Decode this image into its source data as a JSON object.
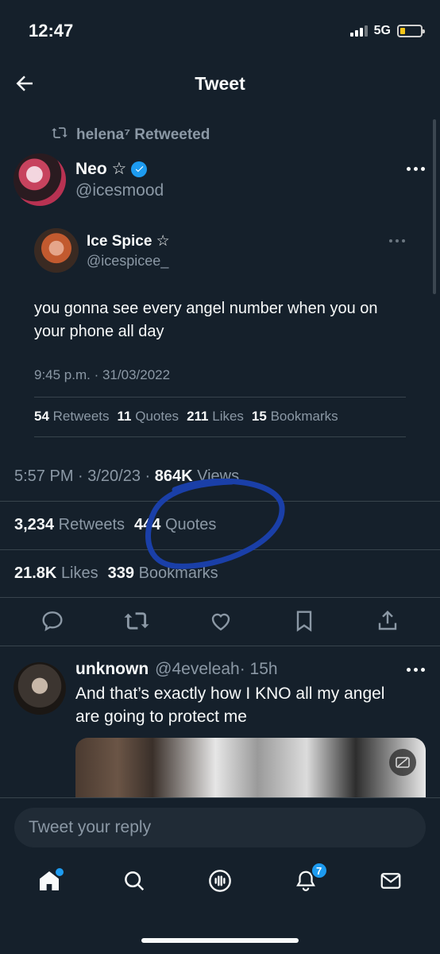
{
  "status_bar": {
    "time": "12:47",
    "network": "5G"
  },
  "header": {
    "title": "Tweet"
  },
  "retweet": {
    "label": "helena⁷ Retweeted"
  },
  "tweet": {
    "author_name": "Neo ☆",
    "author_handle": "@icesmood",
    "timestamp": "5:57 PM · 3/20/23 · ",
    "views_count": "864K",
    "views_label": " Views",
    "retweets_count": "3,234",
    "retweets_label": "Retweets",
    "quotes_count": "444",
    "quotes_label": "Quotes",
    "likes_count": "21.8K",
    "likes_label": "Likes",
    "bookmarks_count": "339",
    "bookmarks_label": "Bookmarks"
  },
  "quoted": {
    "author_name": "Ice Spice ☆",
    "author_handle": "@icespicee_",
    "text": "you gonna see every angel number when you on your phone all day",
    "timestamp": "9:45 p.m. · 31/03/2022",
    "stats": [
      {
        "count": "54",
        "label": "Retweets"
      },
      {
        "count": "11",
        "label": "Quotes"
      },
      {
        "count": "211",
        "label": "Likes"
      },
      {
        "count": "15",
        "label": "Bookmarks"
      }
    ]
  },
  "reply": {
    "author_name": "unknown",
    "author_handle": "@4eveleah",
    "age": "· 15h",
    "text": "And that’s exactly how I KNO all my angel are going to protect me"
  },
  "composer": {
    "placeholder": "Tweet your reply"
  },
  "tabbar": {
    "notification_count": "7"
  },
  "colors": {
    "background": "#15202b",
    "accent": "#1d9bf0",
    "annotation": "#1a3fa8"
  },
  "icons": [
    "back-arrow-icon",
    "retweet-icon",
    "verified-icon",
    "more-icon",
    "reply-icon",
    "like-icon",
    "bookmark-icon",
    "share-icon",
    "home-icon",
    "search-icon",
    "spaces-icon",
    "bell-icon",
    "mail-icon"
  ]
}
